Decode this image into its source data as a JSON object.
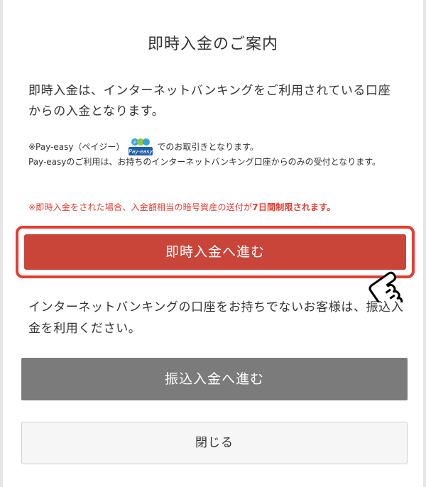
{
  "dialog": {
    "title": "即時入金のご案内",
    "lead": "即時入金は、インターネットバンキングをご利用されている口座からの入金となります。",
    "note_prefix": "※Pay-easy（ペイジー）",
    "note_suffix": "でのお取引きとなります。",
    "note_line2": "Pay-easyのご利用は、お持ちのインターネットバンキング口座からのみの受付となります。",
    "payeasy_logo_text": "Pay-easy",
    "warning_prefix": "※即時入金をされた場合、入金額相当の暗号資産の送付が",
    "warning_bold": "7日間制限されます。",
    "primary_button": "即時入金へ進む",
    "info": "インターネットバンキングの口座をお持ちでないお客様は、振込入金を利用ください。",
    "transfer_button": "振込入金へ進む",
    "close_button": "閉じる"
  },
  "colors": {
    "primary": "#c9453a",
    "highlight_border": "#ea3b30",
    "warning_text": "#e03c31",
    "secondary": "#7b7b7b"
  },
  "icons": {
    "payeasy": "payeasy-logo-icon",
    "pointer": "pointing-hand-icon"
  }
}
